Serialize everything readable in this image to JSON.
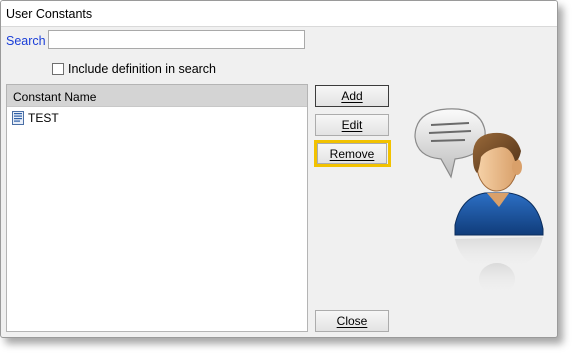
{
  "window": {
    "title": "User Constants"
  },
  "search": {
    "label": "Search",
    "value": "",
    "placeholder": ""
  },
  "include_definition": {
    "label": "Include definition in search",
    "checked": false
  },
  "list": {
    "column_header": "Constant Name",
    "items": [
      {
        "label": "TEST",
        "icon": "document-icon"
      }
    ]
  },
  "buttons": {
    "add": "Add",
    "edit": "Edit",
    "remove": "Remove",
    "close": "Close"
  },
  "colors": {
    "highlight": "#f2c200",
    "search_label": "#1a3ed8"
  },
  "illustration": {
    "icon": "user-speech-bubble-icon"
  }
}
